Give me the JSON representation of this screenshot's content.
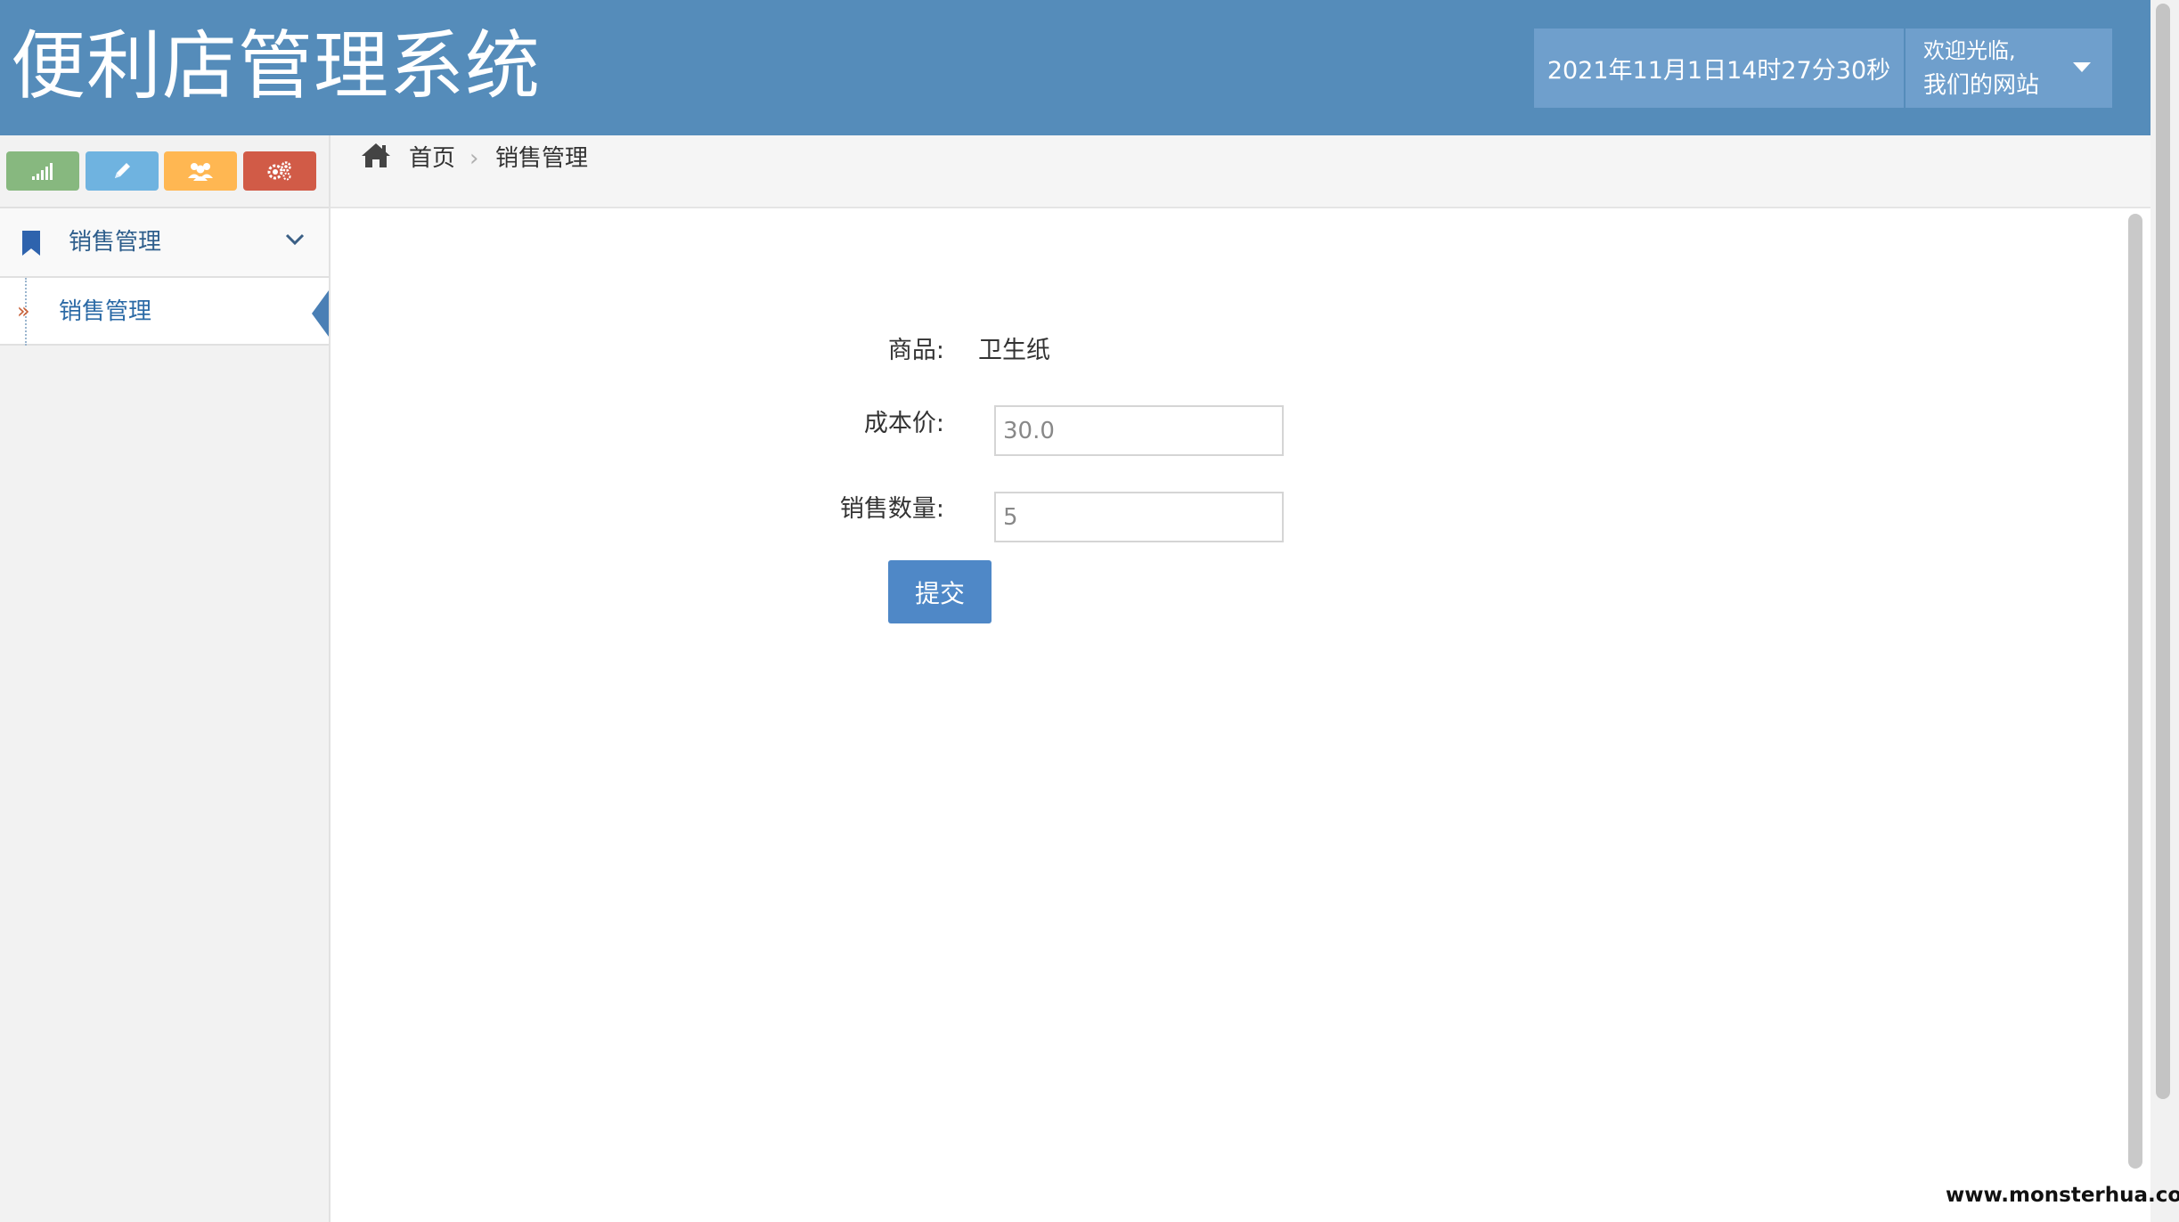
{
  "header": {
    "title": "便利店管理系统",
    "datetime": "2021年11月1日14时27分30秒",
    "welcome_line1": "欢迎光临,",
    "welcome_line2": "我们的网站",
    "background_color": "#558cba"
  },
  "sidebar": {
    "shortcuts": [
      {
        "name": "signal-icon",
        "color": "#87b87f"
      },
      {
        "name": "pencil-icon",
        "color": "#6fb3e0"
      },
      {
        "name": "users-icon",
        "color": "#ffb752"
      },
      {
        "name": "cogs-icon",
        "color": "#d15b47"
      }
    ],
    "menu_group": {
      "label": "销售管理",
      "icon": "bookmark-icon",
      "expanded": true
    },
    "submenu_items": [
      {
        "label": "销售管理",
        "active": true
      }
    ]
  },
  "breadcrumb": {
    "home": "首页",
    "current": "销售管理"
  },
  "form": {
    "product_label": "商品:",
    "product_value": "卫生纸",
    "cost_label": "成本价:",
    "cost_value": "30.0",
    "qty_label": "销售数量:",
    "qty_value": "5",
    "submit_label": "提交"
  },
  "watermark": "www.monsterhua.com"
}
